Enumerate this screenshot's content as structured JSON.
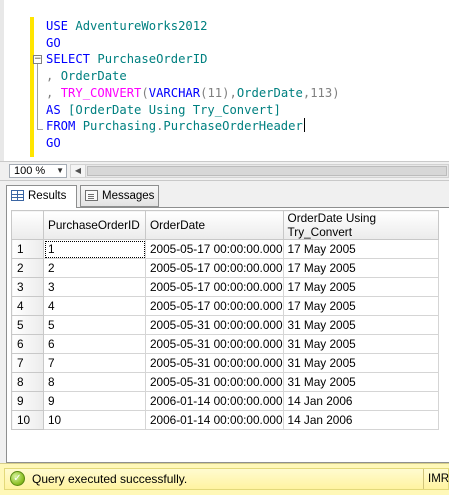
{
  "editor": {
    "lines": [
      [
        {
          "t": "USE ",
          "c": "kw"
        },
        {
          "t": "AdventureWorks2012",
          "c": "tl"
        }
      ],
      [
        {
          "t": "GO",
          "c": "kw"
        }
      ],
      [
        {
          "t": "SELECT ",
          "c": "kw"
        },
        {
          "t": "PurchaseOrderID",
          "c": "tl"
        }
      ],
      [
        {
          "t": ", ",
          "c": "gy"
        },
        {
          "t": "OrderDate",
          "c": "tl"
        }
      ],
      [
        {
          "t": ", ",
          "c": "gy"
        },
        {
          "t": "TRY_CONVERT",
          "c": "fn"
        },
        {
          "t": "(",
          "c": "gy"
        },
        {
          "t": "VARCHAR",
          "c": "kw"
        },
        {
          "t": "(11),",
          "c": "gy"
        },
        {
          "t": "OrderDate",
          "c": "tl"
        },
        {
          "t": ",113)",
          "c": "gy"
        }
      ],
      [
        {
          "t": "AS ",
          "c": "kw"
        },
        {
          "t": "[OrderDate Using Try_Convert]",
          "c": "tl"
        }
      ],
      [
        {
          "t": "FROM ",
          "c": "kw"
        },
        {
          "t": "Purchasing",
          "c": "tl"
        },
        {
          "t": ".",
          "c": "gy"
        },
        {
          "t": "PurchaseOrderHeader",
          "c": "tl"
        },
        {
          "t": "",
          "c": "caret"
        }
      ],
      [
        {
          "t": "GO",
          "c": "kw"
        }
      ]
    ]
  },
  "zoom": {
    "value": "100 %"
  },
  "tabs": {
    "results": "Results",
    "messages": "Messages"
  },
  "grid": {
    "columns": [
      "",
      "PurchaseOrderID",
      "OrderDate",
      "OrderDate Using Try_Convert"
    ],
    "rows": [
      [
        "1",
        "1",
        "2005-05-17 00:00:00.000",
        "17 May 2005"
      ],
      [
        "2",
        "2",
        "2005-05-17 00:00:00.000",
        "17 May 2005"
      ],
      [
        "3",
        "3",
        "2005-05-17 00:00:00.000",
        "17 May 2005"
      ],
      [
        "4",
        "4",
        "2005-05-17 00:00:00.000",
        "17 May 2005"
      ],
      [
        "5",
        "5",
        "2005-05-31 00:00:00.000",
        "31 May 2005"
      ],
      [
        "6",
        "6",
        "2005-05-31 00:00:00.000",
        "31 May 2005"
      ],
      [
        "7",
        "7",
        "2005-05-31 00:00:00.000",
        "31 May 2005"
      ],
      [
        "8",
        "8",
        "2005-05-31 00:00:00.000",
        "31 May 2005"
      ],
      [
        "9",
        "9",
        "2006-01-14 00:00:00.000",
        "14 Jan 2006"
      ],
      [
        "10",
        "10",
        "2006-01-14 00:00:00.000",
        "14 Jan 2006"
      ]
    ]
  },
  "status": {
    "message": "Query executed successfully.",
    "server": "IMRA"
  }
}
